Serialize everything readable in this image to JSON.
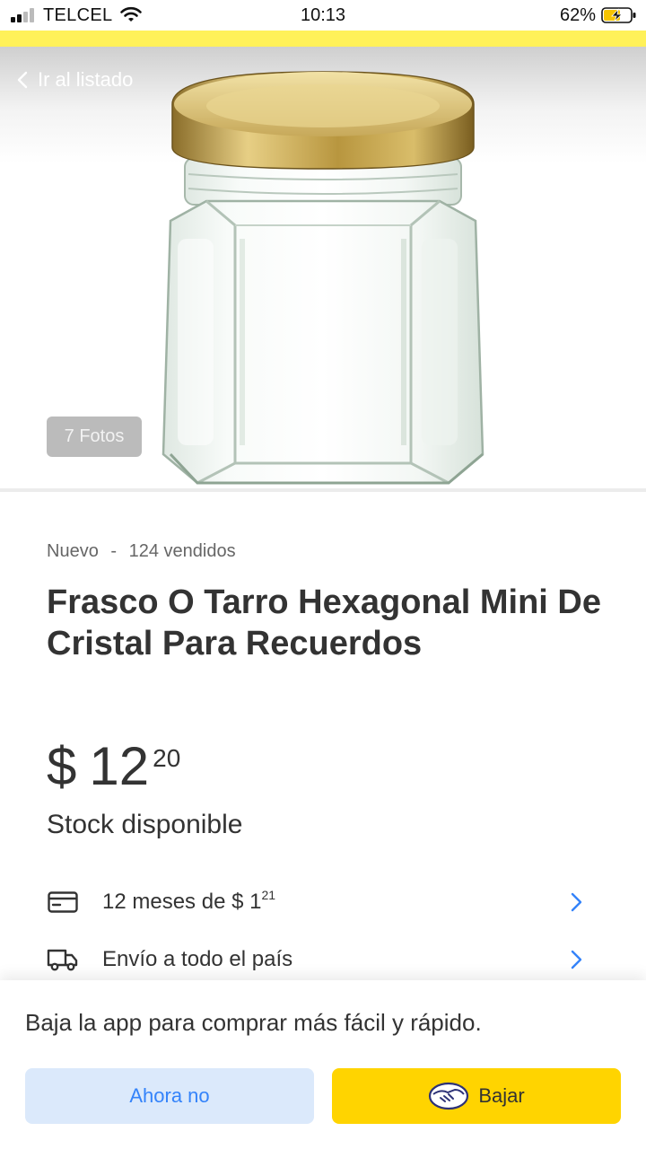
{
  "status_bar": {
    "carrier": "TELCEL",
    "time": "10:13",
    "battery": "62%",
    "battery_level": 0.62
  },
  "gallery": {
    "back_label": "Ir al listado",
    "photos_badge": "7 Fotos",
    "image": "glass-jar-with-gold-lid"
  },
  "product": {
    "condition": "Nuevo",
    "separator": "-",
    "sold": "124 vendidos",
    "title": "Frasco O Tarro Hexagonal Mini De Cristal Para Recuerdos",
    "price": {
      "currency": "$",
      "whole": "12",
      "cents": "20"
    },
    "stock": "Stock disponible"
  },
  "info_rows": [
    {
      "icon": "credit-card-icon",
      "text": "12 meses de $ 1",
      "sup": "21",
      "chevron": "chevron-right-icon"
    },
    {
      "icon": "truck-icon",
      "text": "Envío a todo el país",
      "chevron": "chevron-right-icon"
    }
  ],
  "app_banner": {
    "message": "Baja la app para comprar más fácil y rápido.",
    "secondary_button": "Ahora no",
    "primary_button": "Bajar",
    "primary_icon": "handshake-logo-icon"
  },
  "colors": {
    "accent_yellow": "#fff159",
    "button_yellow": "#ffd400",
    "link_blue": "#3483fa",
    "secondary_bg": "#dbe9fb"
  }
}
